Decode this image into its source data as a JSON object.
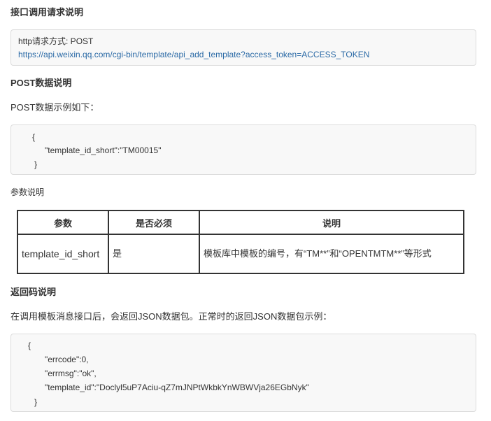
{
  "sections": {
    "request_heading": "接口调用请求说明",
    "request_box": {
      "method_line": "http请求方式: POST",
      "url": "https://api.weixin.qq.com/cgi-bin/template/api_add_template?access_token=ACCESS_TOKEN"
    },
    "post_heading": "POST数据说明",
    "post_intro": "POST数据示例如下：",
    "post_code": {
      "open": "{",
      "line1": "\"template_id_short\":\"TM00015\"",
      "close": "}"
    },
    "params_heading": "参数说明",
    "params_table": {
      "headers": [
        "参数",
        "是否必须",
        "说明"
      ],
      "rows": [
        {
          "name": "template_id_short",
          "required": "是",
          "desc": "模板库中模板的编号，有“TM**”和“OPENTMTM**”等形式"
        }
      ]
    },
    "return_heading": "返回码说明",
    "return_intro": "在调用模板消息接口后，会返回JSON数据包。正常时的返回JSON数据包示例：",
    "return_code": {
      "open": "{",
      "line1": "\"errcode\":0,",
      "line2": "\"errmsg\":\"ok\",",
      "line3": "\"template_id\":\"Doclyl5uP7Aciu-qZ7mJNPtWkbkYnWBWVja26EGbNyk\"",
      "close": "}"
    }
  }
}
